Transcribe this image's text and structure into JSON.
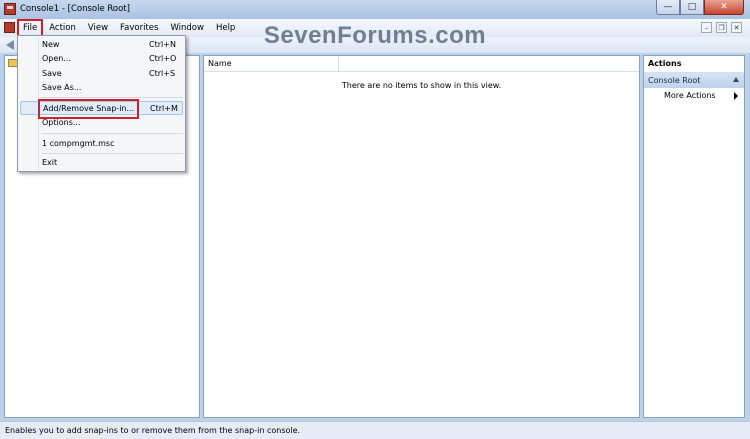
{
  "window": {
    "title": "Console1 - [Console Root]"
  },
  "window_buttons": {
    "minimize": "—",
    "maximize": "□",
    "close": "✕"
  },
  "menubar": {
    "items": [
      "File",
      "Action",
      "View",
      "Favorites",
      "Window",
      "Help"
    ],
    "active": "File"
  },
  "mdi_buttons": {
    "minimize": "–",
    "restore": "❐",
    "close": "✕"
  },
  "watermark": "SevenForums.com",
  "file_menu": {
    "items": [
      {
        "label": "New",
        "shortcut": "Ctrl+N"
      },
      {
        "label": "Open...",
        "shortcut": "Ctrl+O"
      },
      {
        "label": "Save",
        "shortcut": "Ctrl+S"
      },
      {
        "label": "Save As...",
        "shortcut": ""
      },
      {
        "label": "Add/Remove Snap-in...",
        "shortcut": "Ctrl+M"
      },
      {
        "label": "Options...",
        "shortcut": ""
      },
      {
        "label": "1 compmgmt.msc",
        "shortcut": ""
      },
      {
        "label": "Exit",
        "shortcut": ""
      }
    ],
    "highlighted": "Add/Remove Snap-in..."
  },
  "center": {
    "column_name": "Name",
    "empty_message": "There are no items to show in this view."
  },
  "actions": {
    "title": "Actions",
    "section": "Console Root",
    "more_actions": "More Actions"
  },
  "statusbar": {
    "text": "Enables you to add snap-ins to or remove them from the snap-in console."
  },
  "colors": {
    "highlight_outline": "#d0202b",
    "window_frame": "#bcd1ea",
    "actions_section": "#bdd2ec"
  },
  "icons": [
    "app-icon",
    "back-arrow-icon",
    "folder-icon",
    "collapse-arrow-icon",
    "submenu-arrow-icon"
  ]
}
